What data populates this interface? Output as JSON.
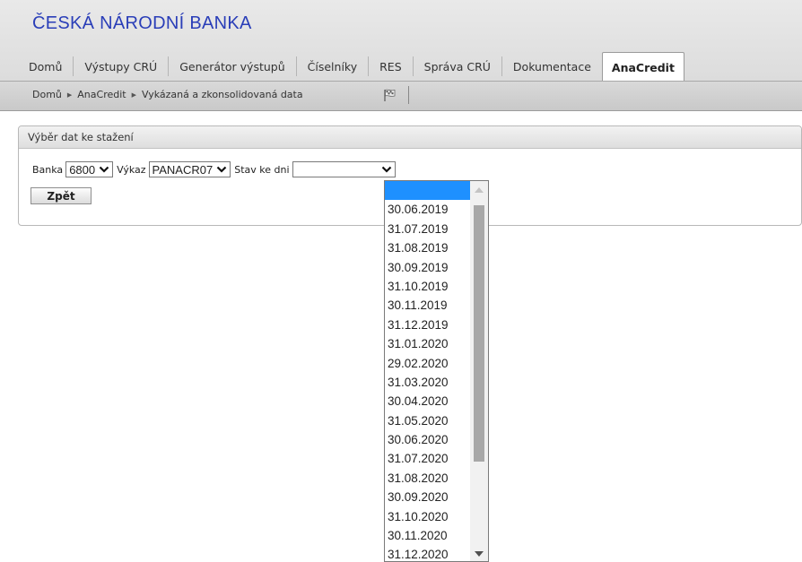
{
  "brand": "ČESKÁ NÁRODNÍ BANKA",
  "tabs": [
    {
      "label": "Domů"
    },
    {
      "label": "Výstupy CRÚ"
    },
    {
      "label": "Generátor výstupů"
    },
    {
      "label": "Číselníky"
    },
    {
      "label": "RES"
    },
    {
      "label": "Správa CRÚ"
    },
    {
      "label": "Dokumentace"
    },
    {
      "label": "AnaCredit"
    }
  ],
  "breadcrumb": [
    "Domů",
    "AnaCredit",
    "Vykázaná a zkonsolidovaná data"
  ],
  "panel": {
    "title": "Výběr dat ke stažení",
    "bank_label": "Banka",
    "bank_value": "6800",
    "report_label": "Výkaz",
    "report_value": "PANACR07",
    "date_label": "Stav ke dni",
    "date_value": "",
    "back_label": "Zpět"
  },
  "date_options": [
    "",
    "30.06.2019",
    "31.07.2019",
    "31.08.2019",
    "30.09.2019",
    "31.10.2019",
    "30.11.2019",
    "31.12.2019",
    "31.01.2020",
    "29.02.2020",
    "31.03.2020",
    "30.04.2020",
    "31.05.2020",
    "30.06.2020",
    "31.07.2020",
    "31.08.2020",
    "30.09.2020",
    "31.10.2020",
    "30.11.2020",
    "31.12.2020"
  ],
  "colors": {
    "brand": "#2a3eb8",
    "highlight": "#1e90ff"
  }
}
